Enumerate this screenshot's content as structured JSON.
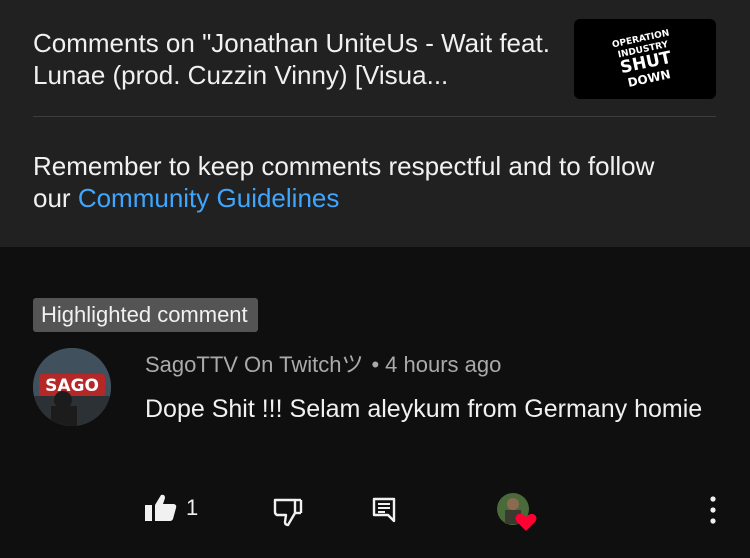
{
  "header": {
    "video_title": "Comments on \"Jonathan UniteUs - Wait feat. Lunae (prod. Cuzzin Vinny) [Visua...",
    "thumbnail_logo_line1": "OPERATION",
    "thumbnail_logo_line2": "INDUSTRY",
    "thumbnail_logo_line3": "SHUT",
    "thumbnail_logo_line4": "DOWN"
  },
  "guidelines": {
    "text": "Remember to keep comments respectful and to follow our ",
    "link_text": "Community Guidelines"
  },
  "comment": {
    "badge": "Highlighted comment",
    "avatar_text": "SAGO",
    "author": "SagoTTV On Twitchツ",
    "separator": "•",
    "time": "4 hours ago",
    "text": "Dope Shit !!! Selam aleykum from Germany homie",
    "like_count": "1"
  },
  "icons": {
    "like": "thumbs-up-icon",
    "dislike": "thumbs-down-icon",
    "reply": "reply-icon",
    "hearted": "creator-heart-icon",
    "more": "more-vert-icon"
  },
  "colors": {
    "background": "#0f0f0f",
    "header_background": "#212121",
    "link": "#3ea6ff",
    "badge": "#545454",
    "secondary_text": "#aaaaaa",
    "heart": "#ff0033"
  }
}
